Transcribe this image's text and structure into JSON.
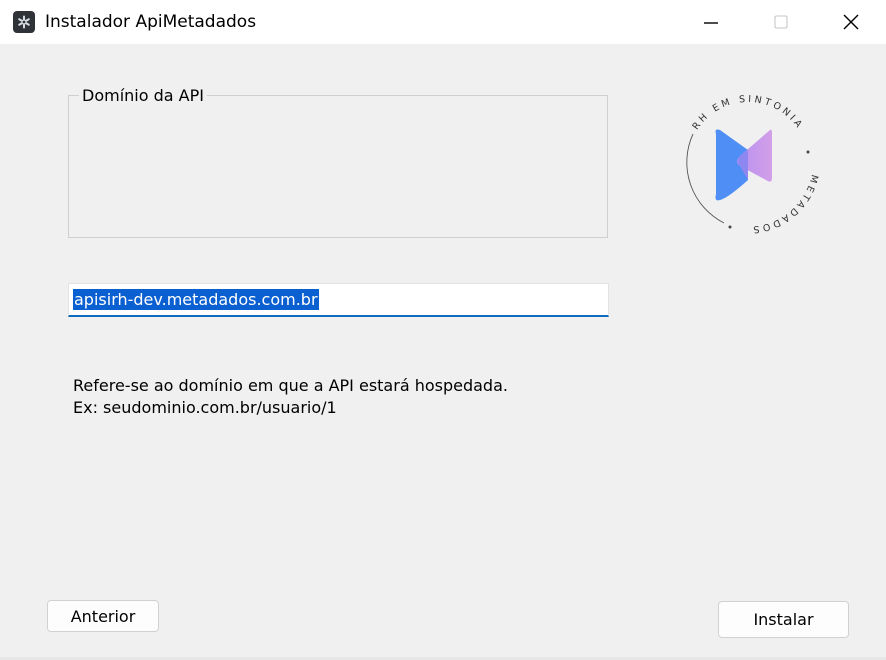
{
  "window": {
    "title": "Instalador ApiMetadados",
    "app_icon": "asterisk-gear-icon"
  },
  "titlebar_buttons": {
    "minimize": "minimize-icon",
    "maximize": "maximize-icon",
    "close": "close-icon"
  },
  "form": {
    "group_label": "Domínio da API",
    "domain_value": "apisirh-dev.metadados.com.br",
    "help_line1": "Refere-se ao domínio em que a API estará hospedada.",
    "help_line2": "Ex: seudominio.com.br/usuario/1"
  },
  "logo": {
    "text_top": "RH EM SINTONIA",
    "text_bottom": "METADADOS"
  },
  "buttons": {
    "previous": "Anterior",
    "install": "Instalar"
  },
  "colors": {
    "accent": "#0f6cbd",
    "selection": "#0a5fd1",
    "logo_blue": "#4f8ff5",
    "logo_purple": "#c08ae6"
  }
}
